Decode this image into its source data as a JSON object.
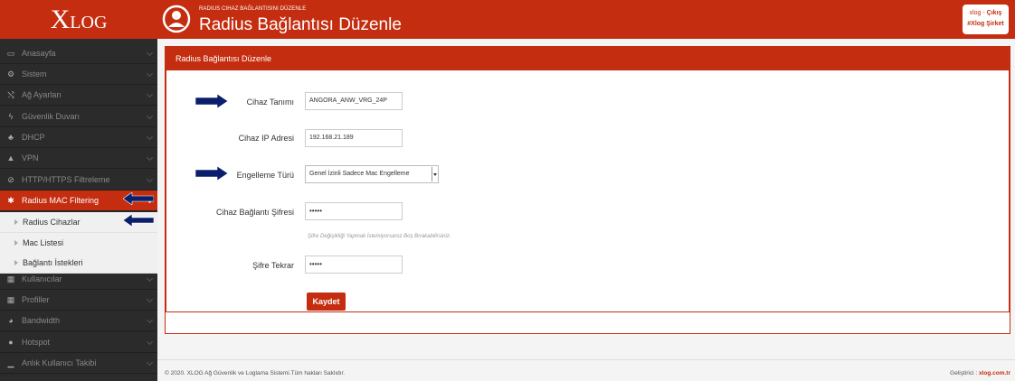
{
  "brand": {
    "logo_x": "X",
    "logo_rest": "LOG"
  },
  "header": {
    "subtitle": "RADIUS CIHAZ BAĞLANTISINI DÜZENLE",
    "title": "Radius Bağlantısı Düzenle"
  },
  "user": {
    "name": "xlog",
    "separator": " - ",
    "logout": "Çıkış",
    "company": "#Xlog Şirket"
  },
  "sidebar": {
    "items": [
      {
        "label": "Anasayfa",
        "icon": "laptop-icon",
        "glyph": "▭"
      },
      {
        "label": "Sistem",
        "icon": "cogs-icon",
        "glyph": "⚙"
      },
      {
        "label": "Ağ Ayarları",
        "icon": "random-icon",
        "glyph": "⤭"
      },
      {
        "label": "Güvenlik Duvarı",
        "icon": "bolt-icon",
        "glyph": "ϟ"
      },
      {
        "label": "DHCP",
        "icon": "sitemap-icon",
        "glyph": "♣"
      },
      {
        "label": "VPN",
        "icon": "road-icon",
        "glyph": "▲"
      },
      {
        "label": "HTTP/HTTPS Filtreleme",
        "icon": "eye-slash-icon",
        "glyph": "⊘"
      },
      {
        "label": "Radius MAC Filtering",
        "icon": "asterisk-icon",
        "glyph": "✱"
      },
      {
        "label": "Kullanıcılar",
        "icon": "th-large-icon",
        "glyph": "▦"
      },
      {
        "label": "Profiller",
        "icon": "th-large-icon",
        "glyph": "▦"
      },
      {
        "label": "Bandwidth",
        "icon": "dashboard-icon",
        "glyph": "◕"
      },
      {
        "label": "Hotspot",
        "icon": "globe-icon",
        "glyph": "●"
      },
      {
        "label": "Anlık Kullanıcı Takibi",
        "icon": "signal-icon",
        "glyph": "▁"
      }
    ],
    "subitems": [
      {
        "label": "Radius Cihazlar"
      },
      {
        "label": "Mac Listesi"
      },
      {
        "label": "Bağlantı İstekleri"
      }
    ]
  },
  "panel": {
    "title": "Radius Bağlantısı Düzenle"
  },
  "form": {
    "device_name_label": "Cihaz Tanımı",
    "device_name_value": "ANGORA_ANW_VRG_24P",
    "ip_label": "Cihaz IP Adresi",
    "ip_value": "192.168.21.189",
    "block_type_label": "Engelleme Türü",
    "block_type_value": "Genel İzinli Sadece Mac Engelleme",
    "password_label": "Cihaz Bağlantı Şifresi",
    "password_value": "•••••",
    "password_hint": "Şifre Değişikliği Yapmak İstemiyorsanız Boş Bırakabilirsiniz.",
    "password_repeat_label": "Şifre Tekrar",
    "password_repeat_value": "•••••",
    "save_label": "Kaydet"
  },
  "footer": {
    "copyright": "© 2020. XLOG Ağ Güvenlik ve Loglama Sistemi.Tüm hakları Saklıdır.",
    "developer_label": "Geliştirici : ",
    "developer_link": "xlog.com.tr"
  },
  "colors": {
    "accent": "#c42d10",
    "sidebar": "#2b2b2b",
    "arrow": "#0a1f6b"
  }
}
